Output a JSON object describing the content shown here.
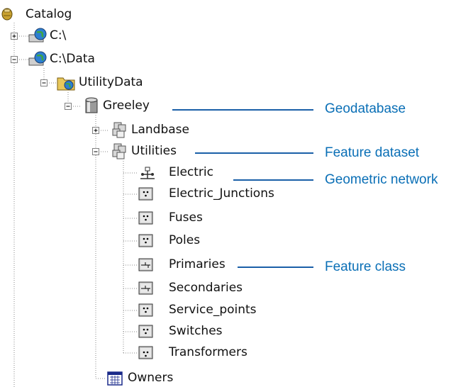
{
  "tree": {
    "root": "Catalog",
    "c_drive": "C:\\",
    "c_data": "C:\\Data",
    "utility_data": "UtilityData",
    "greeley": "Greeley",
    "landbase": "Landbase",
    "utilities": "Utilities",
    "items": [
      "Electric",
      "Electric_Junctions",
      "Fuses",
      "Poles",
      "Primaries",
      "Secondaries",
      "Service_points",
      "Switches",
      "Transformers"
    ],
    "owners": "Owners"
  },
  "callouts": {
    "geodatabase": "Geodatabase",
    "feature_dataset": "Feature dataset",
    "geometric_network": "Geometric network",
    "feature_class": "Feature class"
  },
  "icons": [
    "catalog-icon",
    "globe-drive-icon",
    "folder-icon",
    "database-icon",
    "feature-dataset-icon",
    "network-icon",
    "point-class-icon",
    "line-class-icon",
    "table-icon"
  ],
  "colors": {
    "callout": "#0a6fb6",
    "callout_line": "#1a5fa8",
    "dotted_line": "#8a8a8a"
  }
}
